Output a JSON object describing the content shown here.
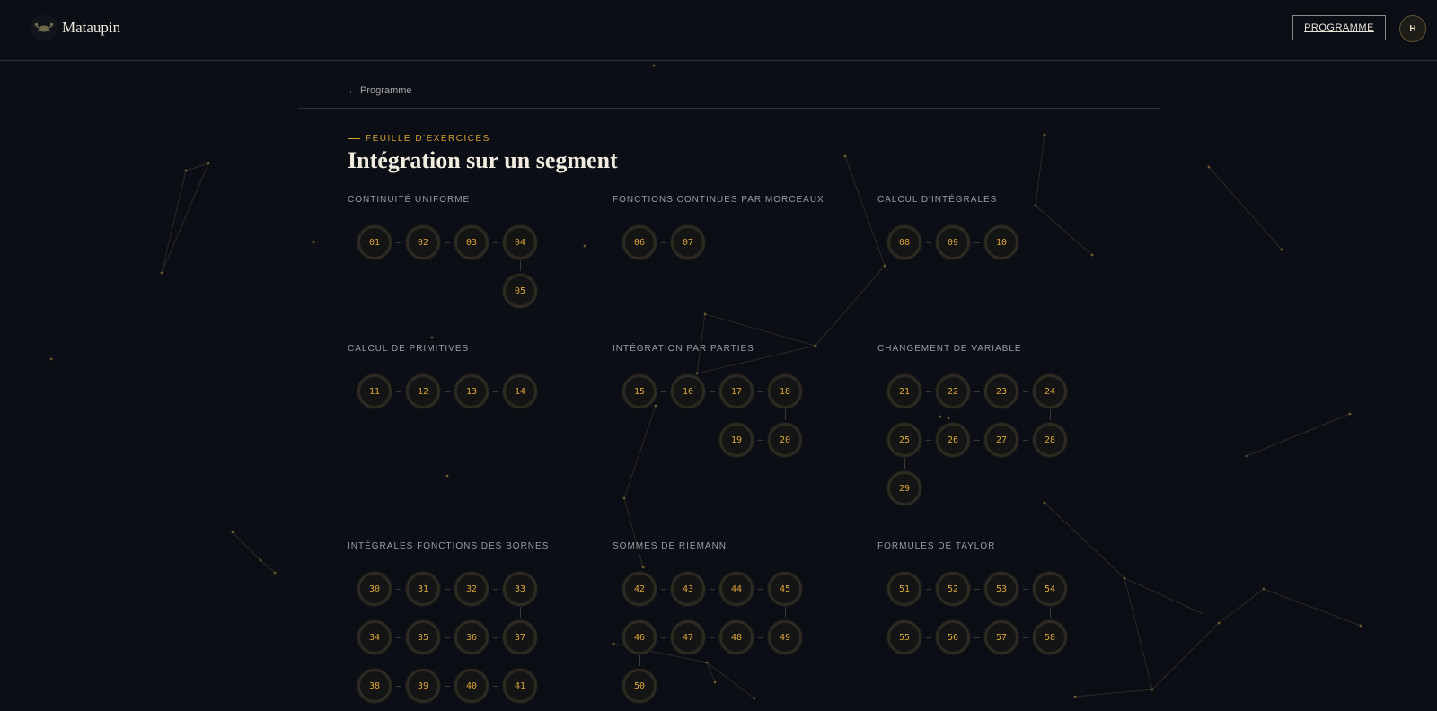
{
  "brand": {
    "name": "Mataupin",
    "logo_icon": "crab-icon"
  },
  "nav": {
    "program_button": "PROGRAMME",
    "avatar_initial": "H"
  },
  "breadcrumb": {
    "back_label": "← Programme"
  },
  "page": {
    "eyebrow": "FEUILLE D'EXERCICES",
    "title": "Intégration sur un segment"
  },
  "colors": {
    "accent": "#d4a032",
    "background": "#0c0e16",
    "node_text": "#d9a63a"
  },
  "sections": [
    {
      "title": "CONTINUITÉ UNIFORME",
      "rows": [
        [
          "01",
          "02",
          "03",
          "04"
        ],
        [
          "05"
        ]
      ]
    },
    {
      "title": "FONCTIONS CONTINUES PAR MORCEAUX",
      "rows": [
        [
          "06",
          "07"
        ]
      ]
    },
    {
      "title": "CALCUL D'INTÉGRALES",
      "rows": [
        [
          "08",
          "09",
          "10"
        ]
      ]
    },
    {
      "title": "CALCUL DE PRIMITIVES",
      "rows": [
        [
          "11",
          "12",
          "13",
          "14"
        ]
      ]
    },
    {
      "title": "INTÉGRATION PAR PARTIES",
      "rows": [
        [
          "15",
          "16",
          "17",
          "18"
        ],
        [
          "20",
          "19"
        ]
      ]
    },
    {
      "title": "CHANGEMENT DE VARIABLE",
      "rows": [
        [
          "21",
          "22",
          "23",
          "24"
        ],
        [
          "28",
          "27",
          "26",
          "25"
        ],
        [
          "29"
        ]
      ]
    },
    {
      "title": "INTÉGRALES FONCTIONS DES BORNES",
      "rows": [
        [
          "30",
          "31",
          "32",
          "33"
        ],
        [
          "37",
          "36",
          "35",
          "34"
        ],
        [
          "38",
          "39",
          "40",
          "41"
        ]
      ]
    },
    {
      "title": "SOMMES DE RIEMANN",
      "rows": [
        [
          "42",
          "43",
          "44",
          "45"
        ],
        [
          "49",
          "48",
          "47",
          "46"
        ],
        [
          "50"
        ]
      ]
    },
    {
      "title": "FORMULES DE TAYLOR",
      "rows": [
        [
          "51",
          "52",
          "53",
          "54"
        ],
        [
          "58",
          "57",
          "56",
          "55"
        ]
      ]
    }
  ]
}
